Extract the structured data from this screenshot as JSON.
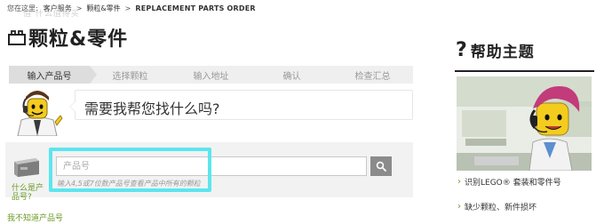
{
  "breadcrumb": {
    "home": "您在这里:",
    "items": [
      "客户服务",
      "颗粒&零件",
      "REPLACEMENT PARTS ORDER"
    ],
    "separators": [
      ">",
      ">",
      ">"
    ]
  },
  "watermark": "值 什么值得买",
  "page_title": "颗粒&零件",
  "steps": [
    {
      "label": "输入产品号",
      "active": true
    },
    {
      "label": "选择颗粒",
      "active": false
    },
    {
      "label": "输入地址",
      "active": false
    },
    {
      "label": "确认",
      "active": false
    },
    {
      "label": "检查汇总",
      "active": false
    }
  ],
  "helper": {
    "bubble_text": "需要我帮您找什么吗?"
  },
  "search": {
    "placeholder": "产品号",
    "hint": "输入4,5或7位数产品号查看产品中所有的颗粒",
    "what_link": "什么是产品号?",
    "button_icon": "magnifier-icon"
  },
  "unknown_link": "我不知道产品号",
  "help": {
    "title": "帮助主题",
    "links": [
      "识别LEGO® 套装和零件号",
      "缺少颗粒、新件损坏"
    ]
  },
  "colors": {
    "accent_green": "#6b9a25",
    "highlight_cyan": "#5ce6ee",
    "step_active": "#dddddd",
    "panel_bg": "#f2f2f2"
  }
}
